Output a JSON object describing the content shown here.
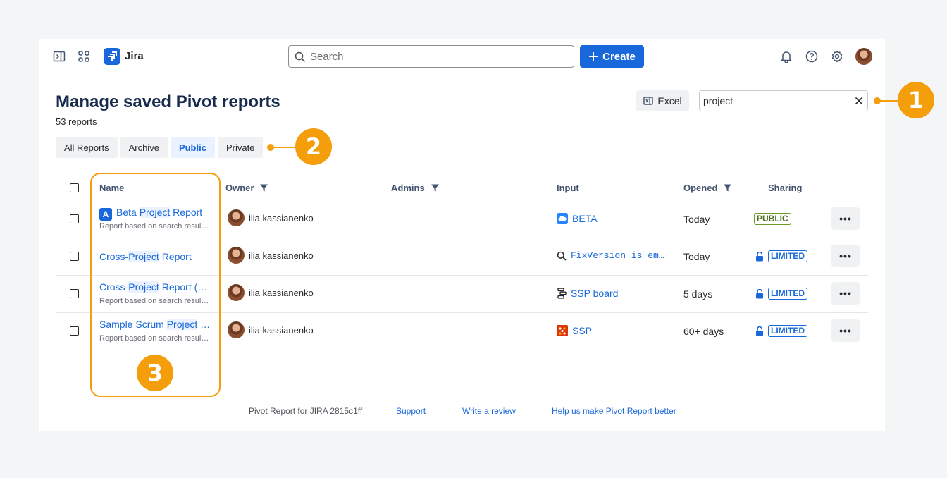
{
  "nav": {
    "app_name": "Jira",
    "search_placeholder": "Search",
    "create_label": "Create"
  },
  "header": {
    "title": "Manage saved Pivot reports",
    "count": "53 reports",
    "excel_label": "Excel",
    "filter_value": "project"
  },
  "tabs": [
    {
      "label": "All Reports",
      "active": false
    },
    {
      "label": "Archive",
      "active": false
    },
    {
      "label": "Public",
      "active": true
    },
    {
      "label": "Private",
      "active": false
    }
  ],
  "table": {
    "columns": {
      "name": "Name",
      "owner": "Owner",
      "admins": "Admins",
      "input": "Input",
      "opened": "Opened",
      "sharing": "Sharing"
    },
    "rows": [
      {
        "name_pre": "Beta ",
        "name_hl": "Project",
        "name_post": " Report",
        "badge": "A",
        "subtitle": "Report based on search results...",
        "owner": "ilia kassianenko",
        "input": "BETA",
        "input_icon": "cloud-project-icon",
        "opened": "Today",
        "sharing": "PUBLIC",
        "more": "•••"
      },
      {
        "name_pre": "Cross-",
        "name_hl": "Project",
        "name_post": " Report",
        "subtitle": "",
        "owner": "ilia kassianenko",
        "input": "FixVersion is em…",
        "input_icon": "search-icon",
        "opened": "Today",
        "sharing": "LIMITED",
        "more": "•••"
      },
      {
        "name_pre": "Cross-",
        "name_hl": "Project",
        "name_post": " Report (c…",
        "subtitle": "Report based on search results...",
        "owner": "ilia kassianenko",
        "input": "SSP board",
        "input_icon": "board-icon",
        "opened": "5 days",
        "sharing": "LIMITED",
        "more": "•••"
      },
      {
        "name_pre": "Sample Scrum ",
        "name_hl": "Project",
        "name_post": " R…",
        "subtitle": "Report based on search results...",
        "owner": "ilia kassianenko",
        "input": "SSP",
        "input_icon": "project-avatar-icon",
        "opened": "60+ days",
        "sharing": "LIMITED",
        "more": "•••"
      }
    ]
  },
  "footer": {
    "version": "Pivot Report for JIRA 2815c1ff",
    "support": "Support",
    "review": "Write a review",
    "feedback": "Help us make Pivot Report better"
  },
  "callouts": [
    "1",
    "2",
    "3"
  ],
  "colors": {
    "accent": "#1868db",
    "callout": "#f59e0b",
    "public_lozenge": "#6a9a23"
  }
}
